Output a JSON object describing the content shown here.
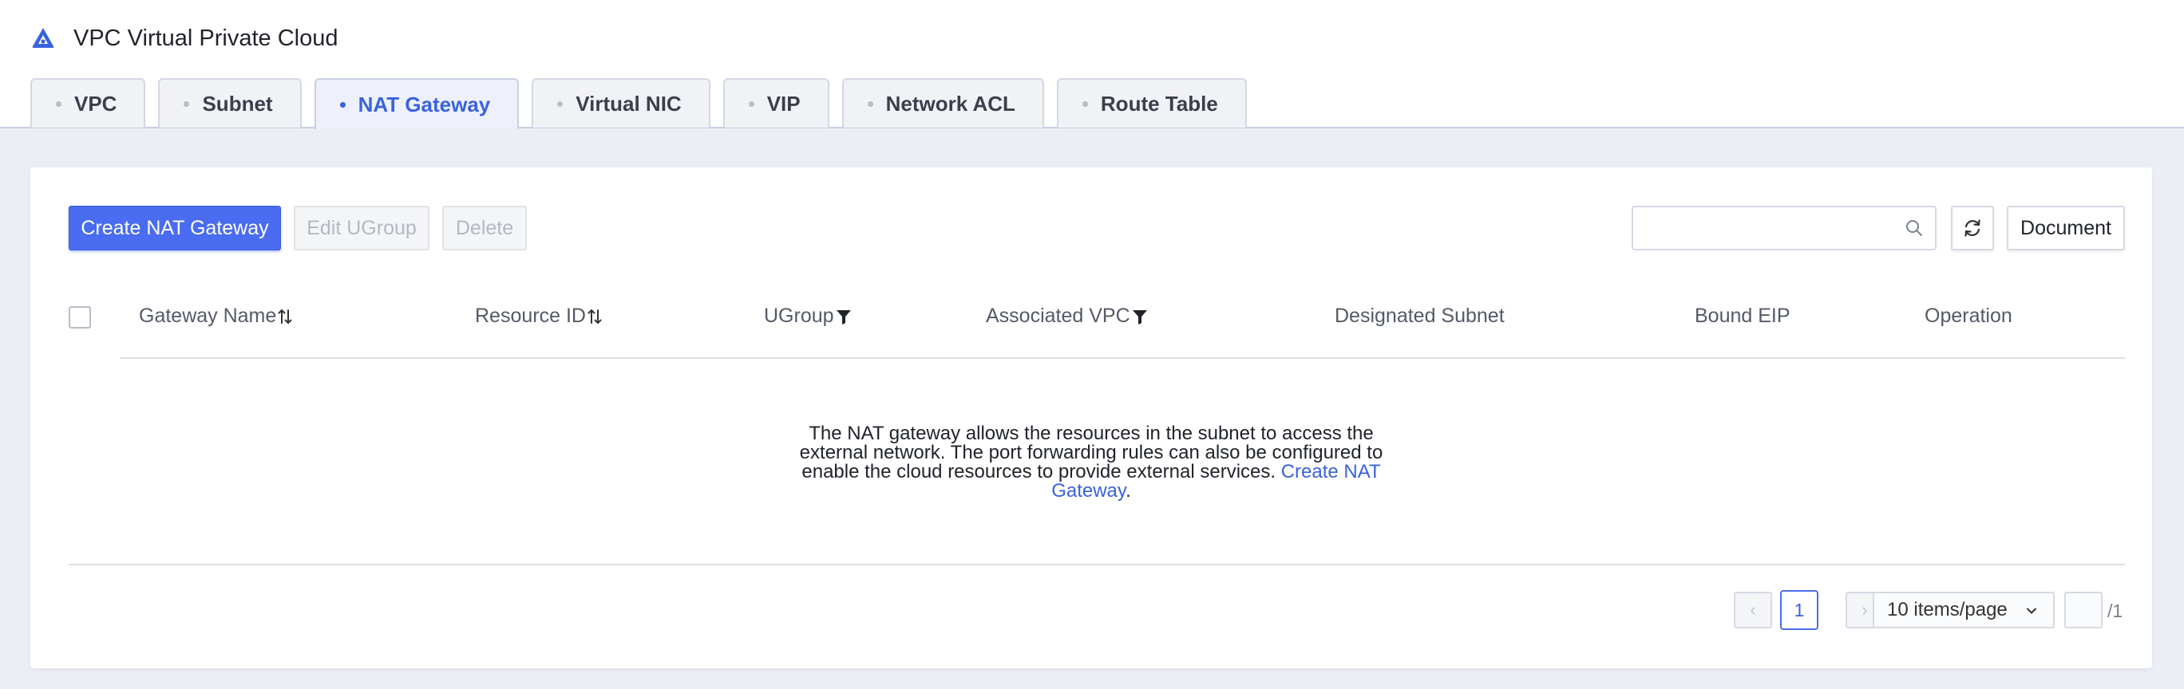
{
  "app": {
    "title": "VPC Virtual Private Cloud"
  },
  "tabs": [
    {
      "label": "VPC",
      "active": false
    },
    {
      "label": "Subnet",
      "active": false
    },
    {
      "label": "NAT Gateway",
      "active": true
    },
    {
      "label": "Virtual NIC",
      "active": false
    },
    {
      "label": "VIP",
      "active": false
    },
    {
      "label": "Network ACL",
      "active": false
    },
    {
      "label": "Route Table",
      "active": false
    }
  ],
  "toolbar": {
    "create_label": "Create NAT Gateway",
    "edit_label": "Edit UGroup",
    "delete_label": "Delete",
    "search_value": "",
    "document_label": "Document"
  },
  "table": {
    "columns": [
      {
        "label": "Gateway Name",
        "icon": "sort-icon"
      },
      {
        "label": "Resource ID",
        "icon": "sort-icon"
      },
      {
        "label": "UGroup",
        "icon": "filter-icon"
      },
      {
        "label": "Associated VPC",
        "icon": "filter-icon"
      },
      {
        "label": "Designated Subnet"
      },
      {
        "label": "Bound EIP"
      },
      {
        "label": "Operation"
      }
    ],
    "empty": {
      "text": "The NAT gateway allows the resources in the subnet to access the external network. The port forwarding rules can also be configured to enable the cloud resources to provide external services. ",
      "link": "Create NAT Gateway",
      "suffix": "."
    }
  },
  "pagination": {
    "prev": "‹",
    "next": "›",
    "current_page": "1",
    "page_size": "10 items/page",
    "total": "/1"
  },
  "colors": {
    "accent": "#4a6cf0",
    "link": "#3a62dc",
    "background": "#eceef5"
  }
}
